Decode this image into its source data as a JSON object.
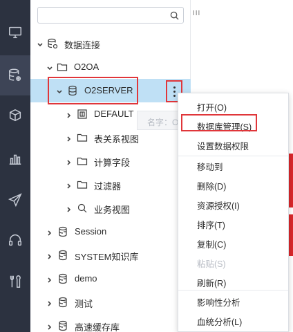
{
  "search": {
    "placeholder": ""
  },
  "toolbar": {
    "mark": "III"
  },
  "rail": {
    "items": [
      {
        "icon": "monitor-icon",
        "active": false
      },
      {
        "icon": "database-settings-icon",
        "active": true
      },
      {
        "icon": "cubes-icon",
        "active": false
      },
      {
        "icon": "bar-chart-icon",
        "active": false
      },
      {
        "icon": "send-icon",
        "active": false
      },
      {
        "icon": "headset-icon",
        "active": false
      },
      {
        "icon": "tools-icon",
        "active": false
      }
    ]
  },
  "tree": {
    "root": {
      "label": "数据连接",
      "icon": "database-settings-icon"
    },
    "o2oa": {
      "label": "O2OA",
      "icon": "folder-icon"
    },
    "o2server": {
      "label": "O2SERVER",
      "icon": "database-icon"
    },
    "children": [
      {
        "label": "DEFAULT",
        "icon": "table-icon"
      },
      {
        "label": "表关系视图",
        "icon": "folder-icon"
      },
      {
        "label": "计算字段",
        "icon": "folder-icon"
      },
      {
        "label": "过滤器",
        "icon": "folder-icon"
      },
      {
        "label": "业务视图",
        "icon": "search-icon"
      }
    ],
    "connections": [
      {
        "label": "Session",
        "icon": "db-file-icon"
      },
      {
        "label": "SYSTEM知识库",
        "icon": "db-file-icon"
      },
      {
        "label": "demo",
        "icon": "db-file-icon"
      },
      {
        "label": "测试",
        "icon": "db-file-icon"
      },
      {
        "label": "高速缓存库",
        "icon": "db-file-icon"
      }
    ]
  },
  "tooltip": {
    "text": "名字：O2SER"
  },
  "context_menu": {
    "groups": [
      [
        {
          "label": "打开(O)",
          "disabled": false
        },
        {
          "label": "数据库管理(S)",
          "disabled": false
        },
        {
          "label": "设置数据权限",
          "disabled": false
        }
      ],
      [
        {
          "label": "移动到",
          "disabled": false
        },
        {
          "label": "删除(D)",
          "disabled": false
        },
        {
          "label": "资源授权(I)",
          "disabled": false
        },
        {
          "label": "排序(T)",
          "disabled": false
        },
        {
          "label": "复制(C)",
          "disabled": false
        },
        {
          "label": "粘贴(S)",
          "disabled": true
        },
        {
          "label": "刷新(R)",
          "disabled": false
        }
      ],
      [
        {
          "label": "影响性分析",
          "disabled": false
        },
        {
          "label": "血统分析(L)",
          "disabled": false
        }
      ]
    ]
  },
  "colors": {
    "rail": "#2c3240",
    "selected_row": "#bfe0f5",
    "highlight": "#e0363a"
  }
}
